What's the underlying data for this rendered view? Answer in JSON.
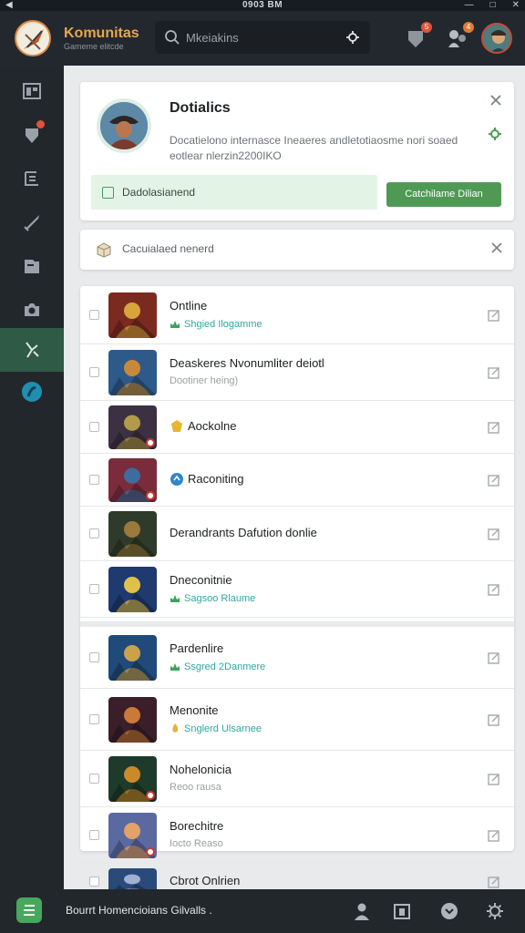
{
  "status_bar": {
    "time": "0903 BM"
  },
  "header": {
    "app_title": "Komunitas",
    "app_subtitle": "Gameme elitcde",
    "search_placeholder": "Mkeiakins",
    "notifications_badge": "5",
    "activity_badge": "4"
  },
  "sidebar": {
    "items": [
      {
        "icon": "dashboard-icon"
      },
      {
        "icon": "shield-icon",
        "badge": true
      },
      {
        "icon": "list-icon"
      },
      {
        "icon": "sword-icon"
      },
      {
        "icon": "folder-icon"
      },
      {
        "icon": "camera-icon"
      },
      {
        "icon": "tools-icon",
        "active": true
      },
      {
        "icon": "globe-icon"
      }
    ]
  },
  "details_card": {
    "title": "Dotialics",
    "description": "Docatielono internasce Ineaeres andletotiaosme nori soaed eotlear nlerzin2200IKO",
    "checkbox_label": "Dadolasianend",
    "button_label": "Catchilame Dilian"
  },
  "notice_card": {
    "text": "Cacuialaed nenerd"
  },
  "games": [
    {
      "title": "Ontline",
      "subtitle": "Shgied Ilogamme",
      "sub_style": "teal",
      "sub_icon": "plant"
    },
    {
      "title": "Deaskeres Nvonumliter deiotl",
      "subtitle": "Dootiner heing)",
      "sub_style": "grey",
      "sub_icon": ""
    },
    {
      "title": "Aockolne",
      "subtitle": "",
      "sub_style": "",
      "sub_icon": "coin",
      "inline_icon": true
    },
    {
      "title": "Raconiting",
      "subtitle": "",
      "sub_style": "",
      "sub_icon": "blue",
      "inline_icon": true
    },
    {
      "title": "Derandrants Dafution donlie",
      "subtitle": "",
      "sub_style": "",
      "sub_icon": ""
    },
    {
      "title": "Dneconitnie",
      "subtitle": "Sagsoo Rlaume",
      "sub_style": "teal",
      "sub_icon": "plant"
    },
    {
      "title": "Pardenlire",
      "subtitle": "Ssgred 2Danmere",
      "sub_style": "teal",
      "sub_icon": "plant"
    },
    {
      "title": "Menonite",
      "subtitle": "Snglerd Ulsarnee",
      "sub_style": "teal",
      "sub_icon": "flame"
    },
    {
      "title": "Nohelonicia",
      "subtitle": "Reoo rausa",
      "sub_style": "grey",
      "sub_icon": ""
    },
    {
      "title": "Borechitre",
      "subtitle": "Iocto Reaso",
      "sub_style": "grey",
      "sub_icon": ""
    },
    {
      "title": "Cbrot Onlrien",
      "subtitle": "",
      "sub_style": "",
      "sub_icon": ""
    }
  ],
  "bottom_bar": {
    "text": "Bourrt Homencioians Gilvalls ."
  },
  "colors": {
    "accent_green": "#4e9a55",
    "sidebar_bg": "#22272c",
    "title_orange": "#e8a64c",
    "teal": "#2fa7a0",
    "badge_red": "#e0533b"
  }
}
